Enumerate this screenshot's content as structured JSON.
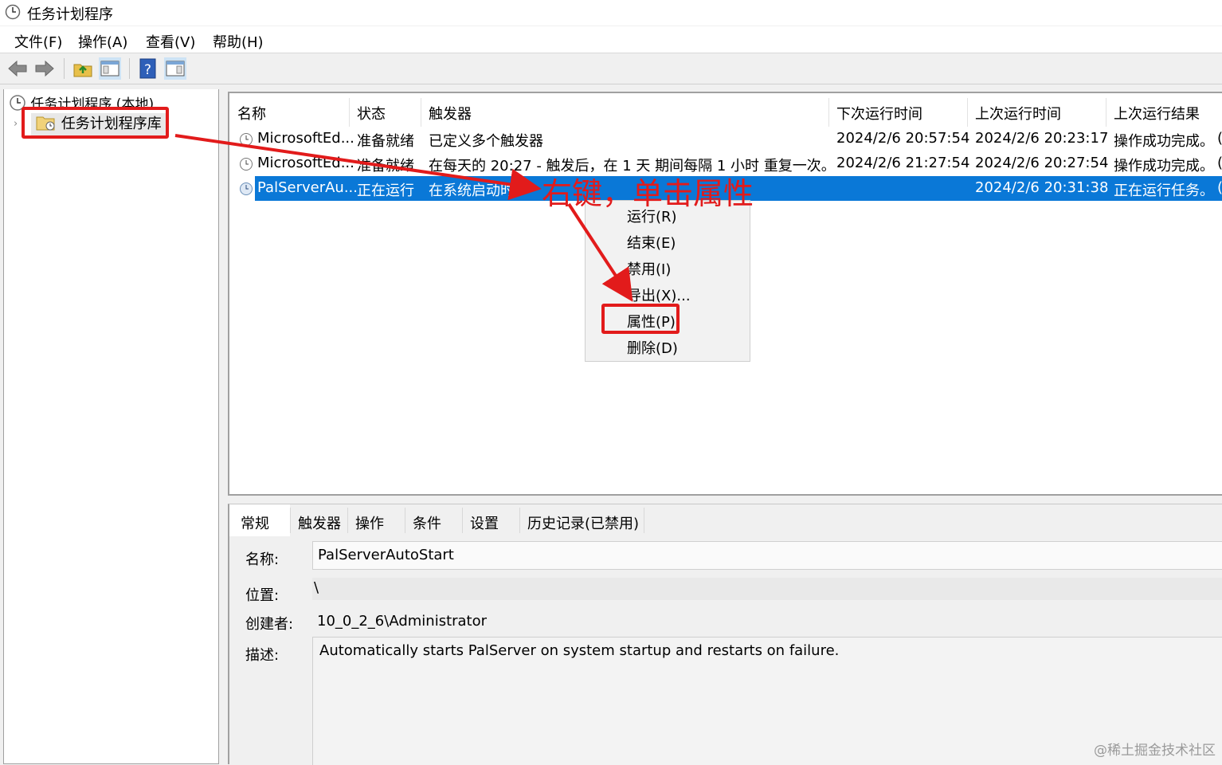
{
  "window": {
    "title": "任务计划程序"
  },
  "menu": [
    "文件(F)",
    "操作(A)",
    "查看(V)",
    "帮助(H)"
  ],
  "toolbar": [
    "back-arrow-icon",
    "forward-arrow-icon",
    "folder-up-icon",
    "show-pane-icon",
    "help-icon",
    "show-action-pane-icon"
  ],
  "tree": {
    "root": "任务计划程序 (本地)",
    "library": "任务计划程序库"
  },
  "columns": [
    "名称",
    "状态",
    "触发器",
    "下次运行时间",
    "上次运行时间",
    "上次运行结果"
  ],
  "rows": [
    {
      "name": "MicrosoftEd...",
      "status": "准备就绪",
      "trigger": "已定义多个触发器",
      "next": "2024/2/6 20:57:54",
      "last": "2024/2/6 20:23:17",
      "result": "操作成功完成。",
      "extra": "("
    },
    {
      "name": "MicrosoftEd...",
      "status": "准备就绪",
      "trigger": "在每天的 20:27 - 触发后，在 1 天 期间每隔 1 小时 重复一次。",
      "next": "2024/2/6 21:27:54",
      "last": "2024/2/6 20:27:54",
      "result": "操作成功完成。",
      "extra": "("
    },
    {
      "name": "PalServerAu...",
      "status": "正在运行",
      "trigger": "在系统启动时",
      "next": "",
      "last": "2024/2/6 20:31:38",
      "result": "正在运行任务。",
      "extra": "("
    }
  ],
  "annotation": "右键，单击属性",
  "context_menu": [
    "运行(R)",
    "结束(E)",
    "禁用(I)",
    "导出(X)...",
    "属性(P)",
    "删除(D)"
  ],
  "tabs": [
    "常规",
    "触发器",
    "操作",
    "条件",
    "设置",
    "历史记录(已禁用)"
  ],
  "general": {
    "name_label": "名称:",
    "name_value": "PalServerAutoStart",
    "location_label": "位置:",
    "location_value": "\\",
    "author_label": "创建者:",
    "author_value": "10_0_2_6\\Administrator",
    "desc_label": "描述:",
    "desc_value": "Automatically starts PalServer on system startup and restarts on failure."
  },
  "watermark": "@稀土掘金技术社区",
  "colors": {
    "selection": "#0a78d7",
    "annotation_red": "#e21b1b"
  }
}
